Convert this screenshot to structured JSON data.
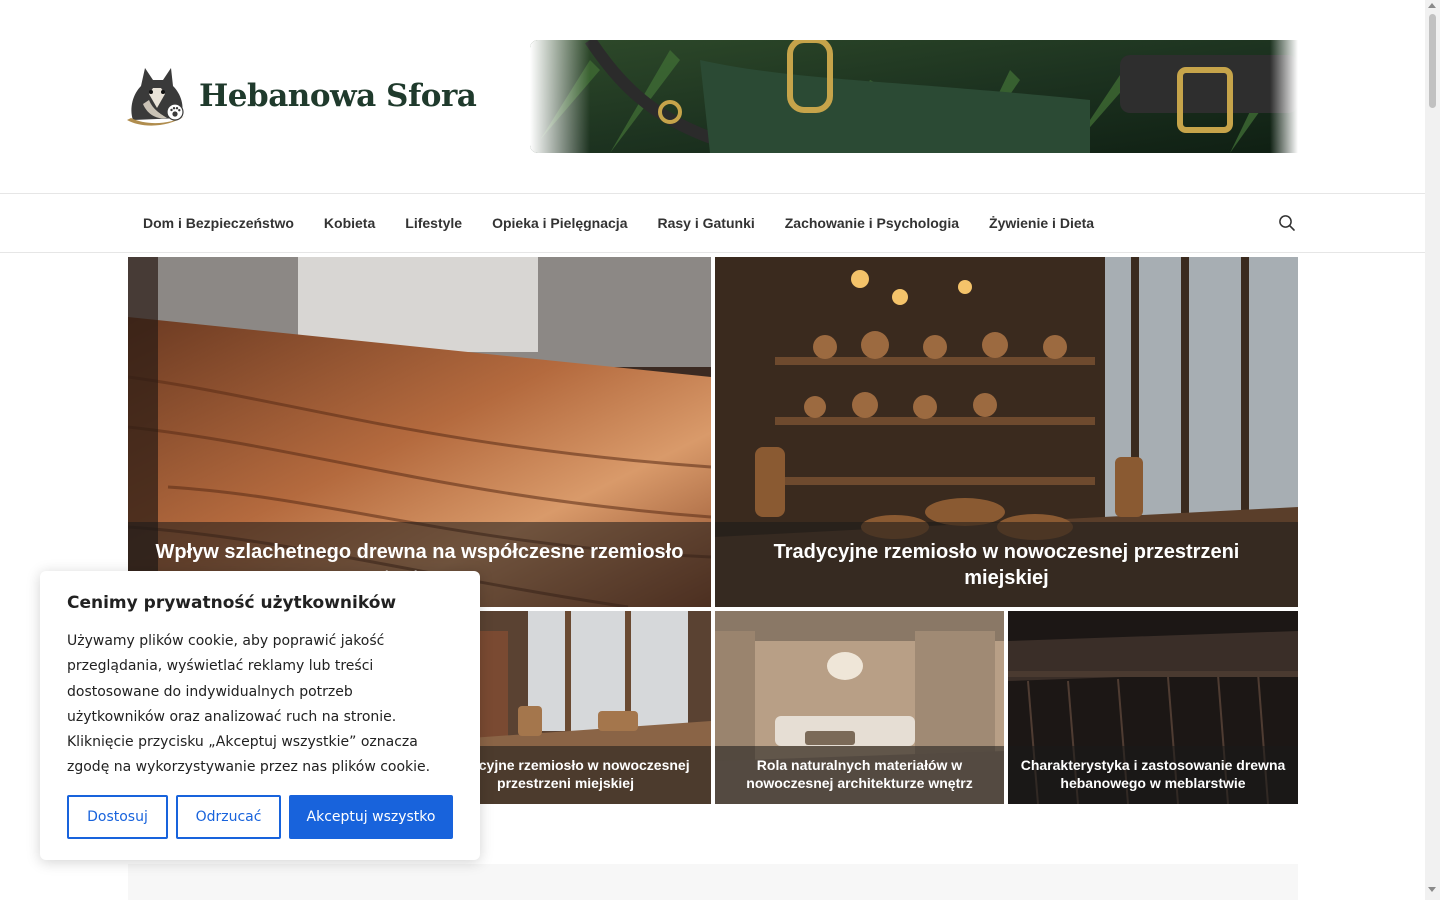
{
  "site": {
    "name": "Hebanowa Sfora",
    "logo_icon": "husky-dog-icon",
    "banner_image": "dog-collars-leash-banner"
  },
  "nav": {
    "items": [
      {
        "label": "Dom i Bezpieczeństwo"
      },
      {
        "label": "Kobieta"
      },
      {
        "label": "Lifestyle"
      },
      {
        "label": "Opieka i Pielęgnacja"
      },
      {
        "label": "Rasy i Gatunki"
      },
      {
        "label": "Zachowanie i Psychologia"
      },
      {
        "label": "Żywienie i Dieta"
      }
    ],
    "search_icon": "search-icon"
  },
  "featured": {
    "posts": [
      {
        "title": "Wpływ szlachetnego drewna na współczesne rzemiosło artystyczne",
        "image": "wood-table-grain"
      },
      {
        "title": "Tradycyjne rzemiosło w nowoczesnej przestrzeni miejskiej",
        "image": "rustic-craft-shop"
      },
      {
        "title": "Tradycyjne rzemiosło w nowoczesnej przestrzeni miejskiej",
        "image": "workshop-by-window"
      },
      {
        "title": "Rola naturalnych materiałów w nowoczesnej architekturze wnętrz",
        "image": "modern-living-room"
      },
      {
        "title": "Charakterystyka i zastosowanie drewna hebanowego w meblarstwie",
        "image": "ebony-furniture"
      }
    ]
  },
  "cookie_banner": {
    "title": "Cenimy prywatność użytkowników",
    "text": "Używamy plików cookie, aby poprawić jakość przeglądania, wyświetlać reklamy lub treści dostosowane do indywidualnych potrzeb użytkowników oraz analizować ruch na stronie. Kliknięcie przycisku „Akceptuj wszystkie” oznacza zgodę na wykorzystywanie przez nas plików cookie.",
    "customize_label": "Dostosuj",
    "reject_label": "Odrzucać",
    "accept_label": "Akceptuj wszystko",
    "accent_color": "#1863dc"
  }
}
